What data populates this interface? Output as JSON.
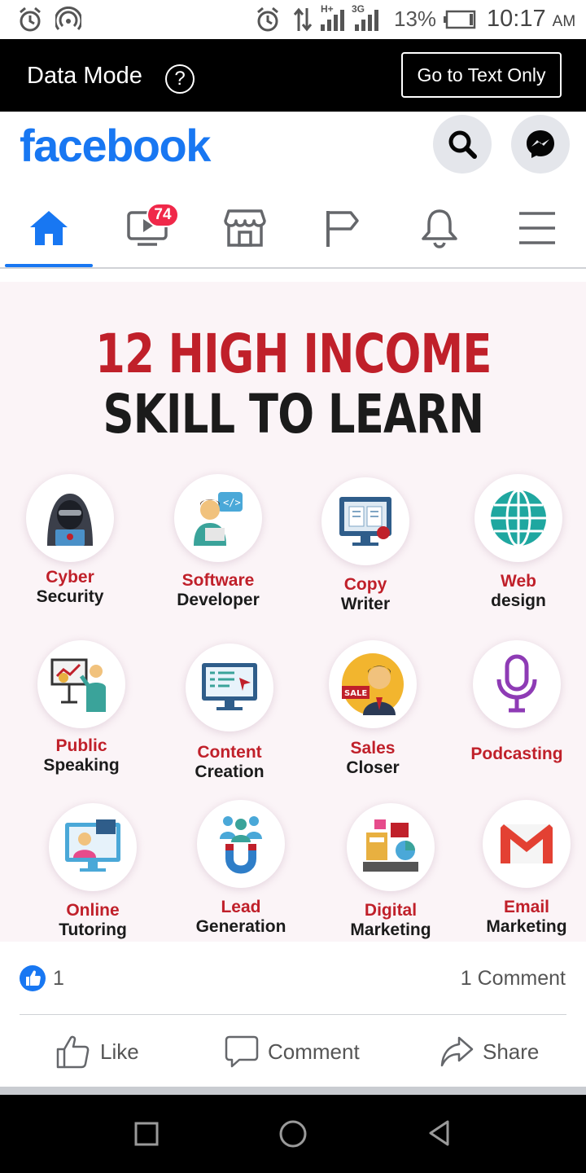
{
  "status_bar": {
    "battery_percent": "13%",
    "time": "10:17",
    "ampm": "AM",
    "network_1": "H+",
    "network_2": "3G"
  },
  "data_mode_bar": {
    "title": "Data Mode",
    "help_symbol": "?",
    "text_only_button": "Go to Text Only"
  },
  "header": {
    "logo": "facebook",
    "brand_color": "#1877f2",
    "icons": [
      "search-icon",
      "messenger-icon"
    ]
  },
  "nav": {
    "tabs": [
      "home-icon",
      "watch-icon",
      "marketplace-icon",
      "pages-icon",
      "notifications-icon",
      "menu-icon"
    ],
    "active_tab": "home-icon",
    "watch_badge": "74"
  },
  "post": {
    "image": {
      "headline_1": "12 HIGH INCOME",
      "headline_2": "SKILL TO LEARN",
      "skills": [
        {
          "line1": "Cyber",
          "line2": "Security",
          "icon": "hacker-icon"
        },
        {
          "line1": "Software",
          "line2": "Developer",
          "icon": "developer-icon"
        },
        {
          "line1": "Copy",
          "line2": "Writer",
          "icon": "writer-icon"
        },
        {
          "line1": "Web",
          "line2": "design",
          "icon": "globe-icon"
        },
        {
          "line1": "Public",
          "line2": "Speaking",
          "icon": "presenter-icon"
        },
        {
          "line1": "Content",
          "line2": "Creation",
          "icon": "monitor-icon"
        },
        {
          "line1": "Sales",
          "line2": "Closer",
          "icon": "salesman-icon"
        },
        {
          "line1": "Podcasting",
          "line2": "",
          "icon": "microphone-icon"
        },
        {
          "line1": "Online",
          "line2": "Tutoring",
          "icon": "tutor-icon"
        },
        {
          "line1": "Lead",
          "line2": "Generation",
          "icon": "magnet-icon"
        },
        {
          "line1": "Digital",
          "line2": "Marketing",
          "icon": "marketing-icon"
        },
        {
          "line1": "Email",
          "line2": "Marketing",
          "icon": "gmail-icon"
        }
      ]
    },
    "reactions": {
      "like_count": "1",
      "comment_count": "1 Comment"
    },
    "actions": {
      "like": "Like",
      "comment": "Comment",
      "share": "Share"
    }
  },
  "system_nav": [
    "recents-button",
    "home-button",
    "back-button"
  ]
}
